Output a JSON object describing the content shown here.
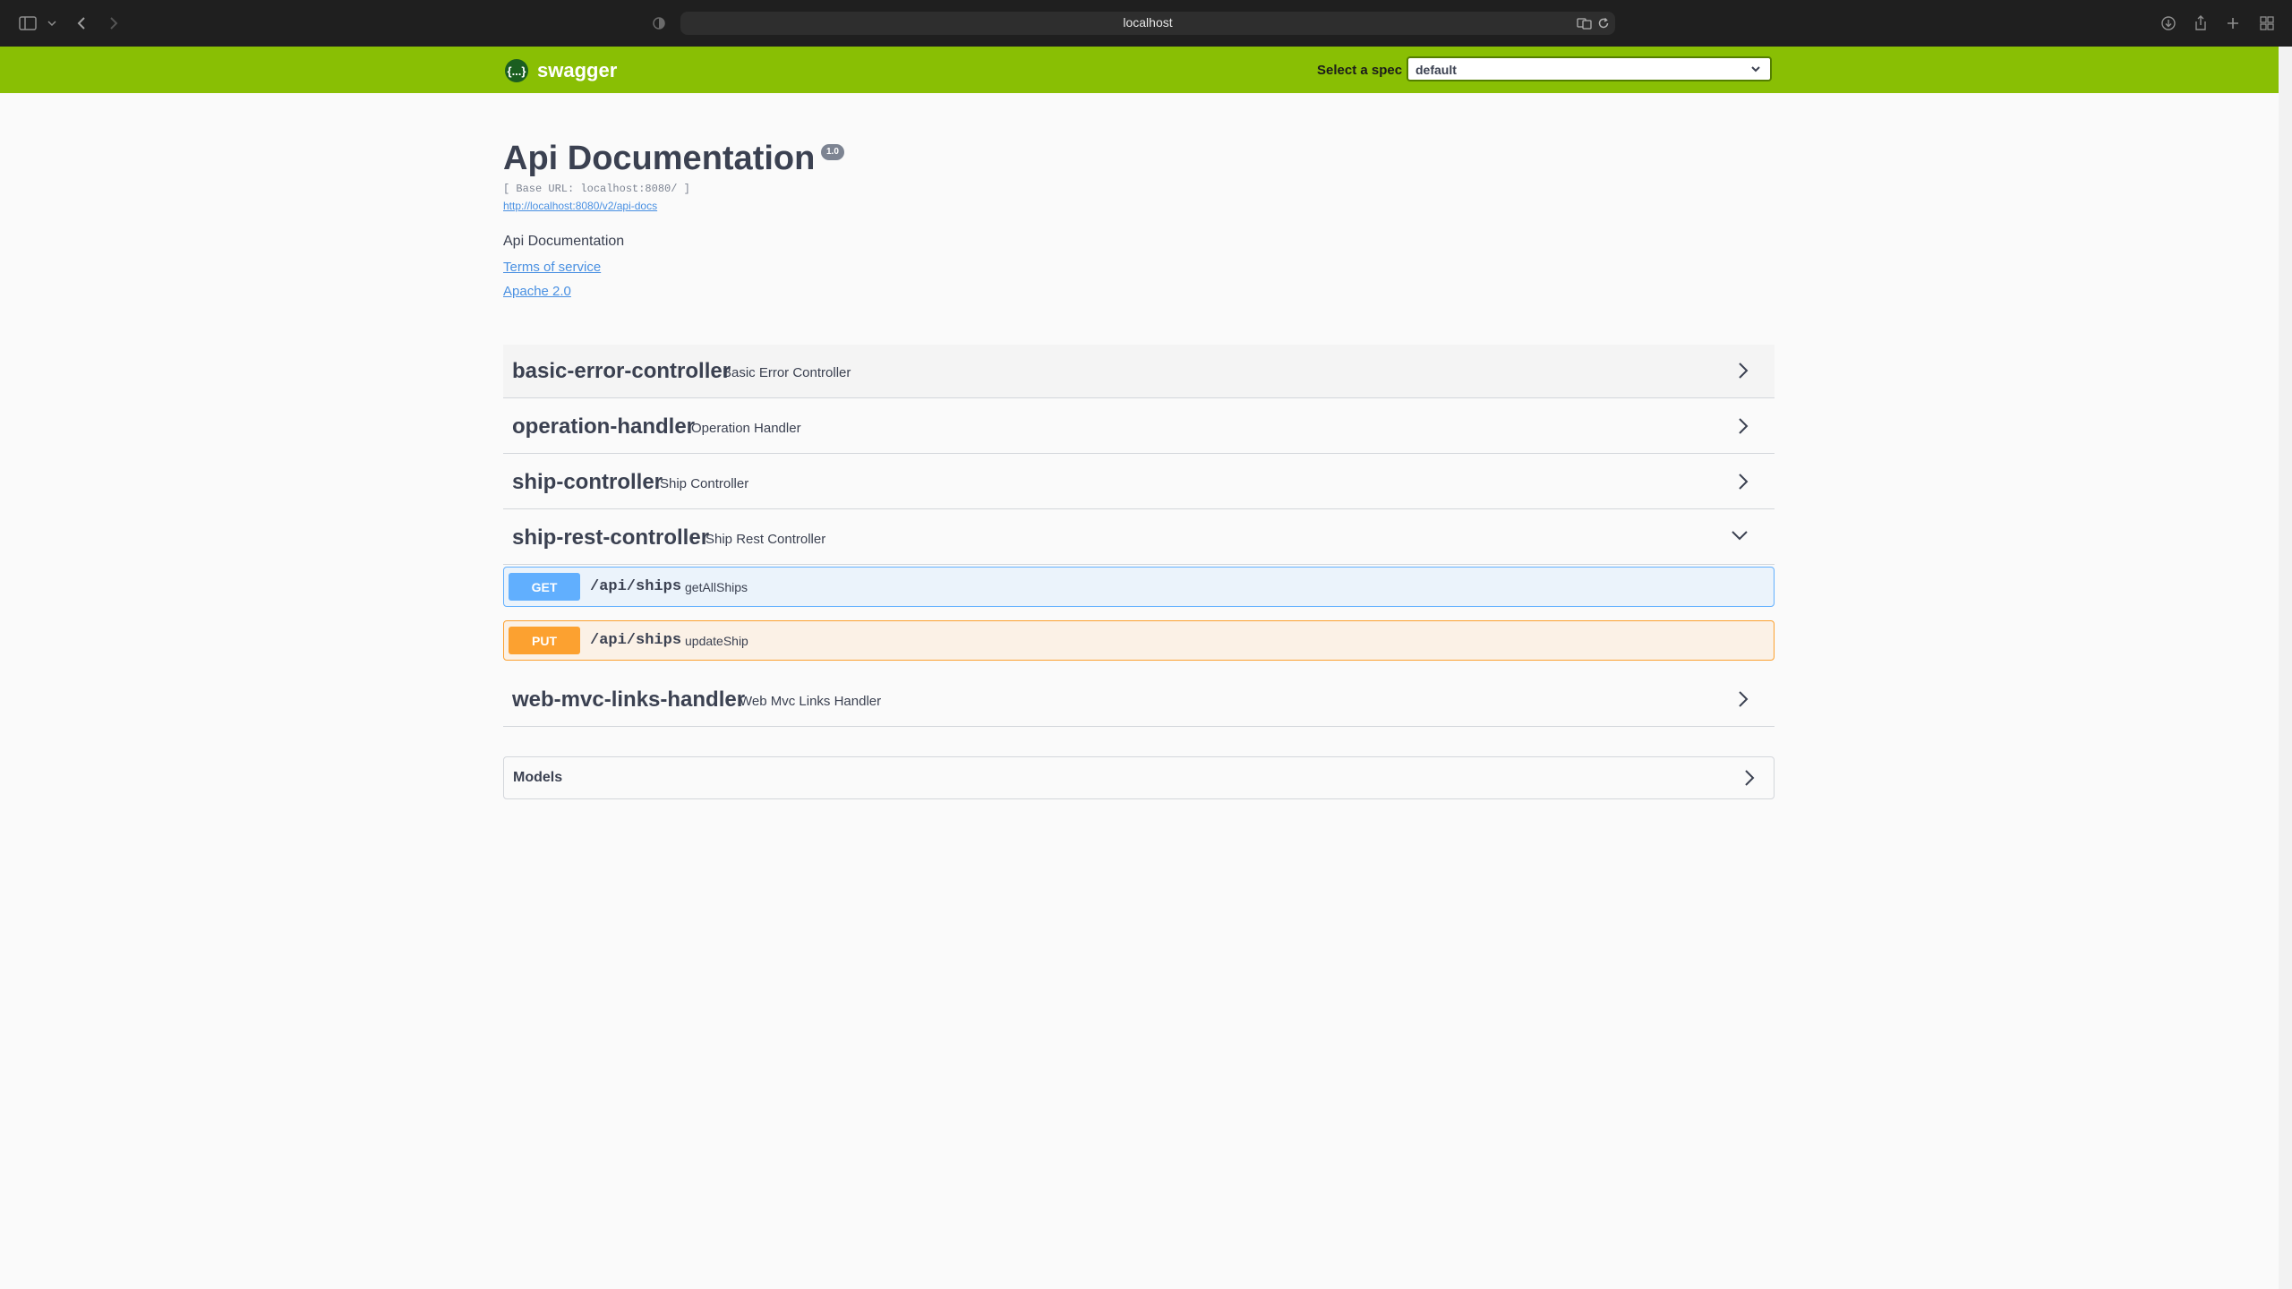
{
  "browser": {
    "address": "localhost",
    "icons": [
      "sidebar-icon",
      "chevron-down-icon",
      "back-icon",
      "forward-icon",
      "shield-icon",
      "translate-icon",
      "reload-icon",
      "download-icon",
      "share-icon",
      "new-tab-icon",
      "tab-overview-icon"
    ]
  },
  "topbar": {
    "logo_text": "swagger",
    "logo_mark": "{...}",
    "spec_label": "Select a spec",
    "spec_value": "default"
  },
  "info": {
    "title": "Api Documentation",
    "version": "1.0",
    "base_url": "[ Base URL: localhost:8080/ ]",
    "docs_link": "http://localhost:8080/v2/api-docs",
    "description": "Api Documentation",
    "terms": "Terms of service",
    "license": "Apache 2.0"
  },
  "tags": [
    {
      "name": "basic-error-controller",
      "desc": "Basic Error Controller",
      "expanded": false
    },
    {
      "name": "operation-handler",
      "desc": "Operation Handler",
      "expanded": false
    },
    {
      "name": "ship-controller",
      "desc": "Ship Controller",
      "expanded": false
    },
    {
      "name": "ship-rest-controller",
      "desc": "Ship Rest Controller",
      "expanded": true
    },
    {
      "name": "web-mvc-links-handler",
      "desc": "Web Mvc Links Handler",
      "expanded": false
    }
  ],
  "operations": [
    {
      "method": "GET",
      "path": "/api/ships",
      "summary": "getAllShips",
      "color": "#61affe"
    },
    {
      "method": "PUT",
      "path": "/api/ships",
      "summary": "updateShip",
      "color": "#fca130"
    }
  ],
  "models": {
    "title": "Models"
  },
  "colors": {
    "topbar": "#89bf04",
    "link": "#4990e2",
    "text": "#3b4151"
  }
}
